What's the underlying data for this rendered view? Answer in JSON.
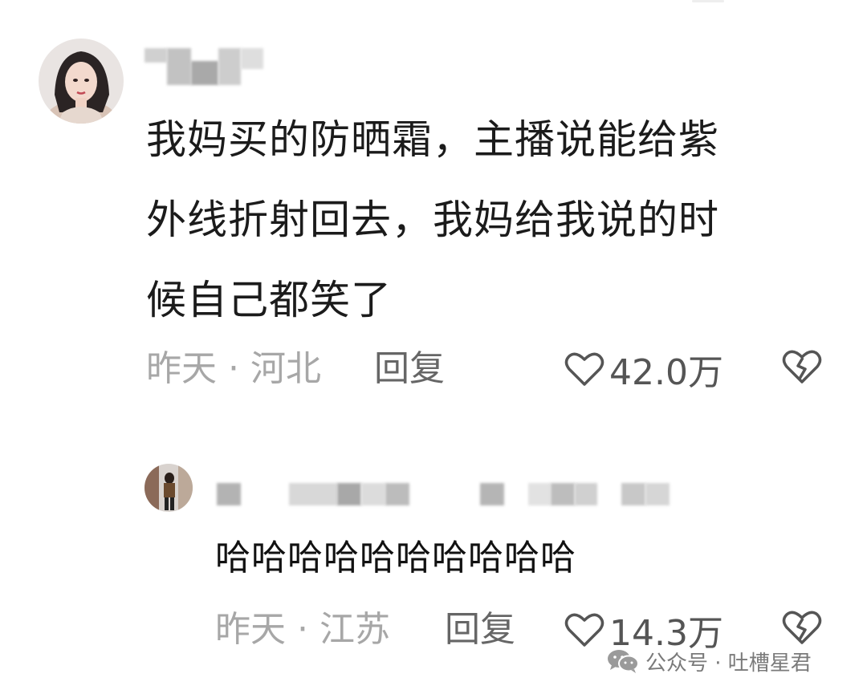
{
  "comment": {
    "text": "我妈买的防晒霜，主播说能给紫\n外线折射回去，我妈给我说的时\n候自己都笑了",
    "time_location": "昨天 · 河北",
    "reply_label": "回复",
    "likes": "42.0万",
    "heart_icon": "heart-outline-icon",
    "dislike_icon": "broken-heart-icon"
  },
  "reply": {
    "text": "哈哈哈哈哈哈哈哈哈哈",
    "time_location": "昨天 · 江苏",
    "reply_label": "回复",
    "likes": "14.3万",
    "heart_icon": "heart-outline-icon",
    "dislike_icon": "broken-heart-icon"
  },
  "watermark": {
    "text": "公众号 · 吐槽星君",
    "icon": "wechat-icon"
  },
  "colors": {
    "meta_gray": "#a7a7a7",
    "reply_gray": "#666666",
    "text_dark": "#1b1b1b"
  }
}
